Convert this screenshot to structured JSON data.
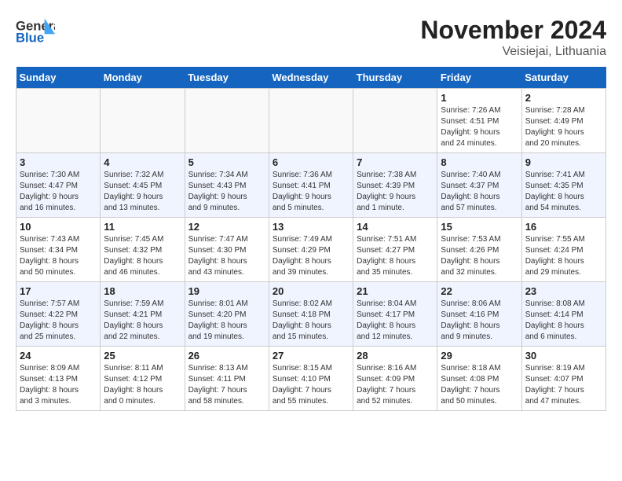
{
  "header": {
    "logo_line1": "General",
    "logo_line2": "Blue",
    "month": "November 2024",
    "location": "Veisiejai, Lithuania"
  },
  "weekdays": [
    "Sunday",
    "Monday",
    "Tuesday",
    "Wednesday",
    "Thursday",
    "Friday",
    "Saturday"
  ],
  "weeks": [
    [
      {
        "day": "",
        "info": ""
      },
      {
        "day": "",
        "info": ""
      },
      {
        "day": "",
        "info": ""
      },
      {
        "day": "",
        "info": ""
      },
      {
        "day": "",
        "info": ""
      },
      {
        "day": "1",
        "info": "Sunrise: 7:26 AM\nSunset: 4:51 PM\nDaylight: 9 hours\nand 24 minutes."
      },
      {
        "day": "2",
        "info": "Sunrise: 7:28 AM\nSunset: 4:49 PM\nDaylight: 9 hours\nand 20 minutes."
      }
    ],
    [
      {
        "day": "3",
        "info": "Sunrise: 7:30 AM\nSunset: 4:47 PM\nDaylight: 9 hours\nand 16 minutes."
      },
      {
        "day": "4",
        "info": "Sunrise: 7:32 AM\nSunset: 4:45 PM\nDaylight: 9 hours\nand 13 minutes."
      },
      {
        "day": "5",
        "info": "Sunrise: 7:34 AM\nSunset: 4:43 PM\nDaylight: 9 hours\nand 9 minutes."
      },
      {
        "day": "6",
        "info": "Sunrise: 7:36 AM\nSunset: 4:41 PM\nDaylight: 9 hours\nand 5 minutes."
      },
      {
        "day": "7",
        "info": "Sunrise: 7:38 AM\nSunset: 4:39 PM\nDaylight: 9 hours\nand 1 minute."
      },
      {
        "day": "8",
        "info": "Sunrise: 7:40 AM\nSunset: 4:37 PM\nDaylight: 8 hours\nand 57 minutes."
      },
      {
        "day": "9",
        "info": "Sunrise: 7:41 AM\nSunset: 4:35 PM\nDaylight: 8 hours\nand 54 minutes."
      }
    ],
    [
      {
        "day": "10",
        "info": "Sunrise: 7:43 AM\nSunset: 4:34 PM\nDaylight: 8 hours\nand 50 minutes."
      },
      {
        "day": "11",
        "info": "Sunrise: 7:45 AM\nSunset: 4:32 PM\nDaylight: 8 hours\nand 46 minutes."
      },
      {
        "day": "12",
        "info": "Sunrise: 7:47 AM\nSunset: 4:30 PM\nDaylight: 8 hours\nand 43 minutes."
      },
      {
        "day": "13",
        "info": "Sunrise: 7:49 AM\nSunset: 4:29 PM\nDaylight: 8 hours\nand 39 minutes."
      },
      {
        "day": "14",
        "info": "Sunrise: 7:51 AM\nSunset: 4:27 PM\nDaylight: 8 hours\nand 35 minutes."
      },
      {
        "day": "15",
        "info": "Sunrise: 7:53 AM\nSunset: 4:26 PM\nDaylight: 8 hours\nand 32 minutes."
      },
      {
        "day": "16",
        "info": "Sunrise: 7:55 AM\nSunset: 4:24 PM\nDaylight: 8 hours\nand 29 minutes."
      }
    ],
    [
      {
        "day": "17",
        "info": "Sunrise: 7:57 AM\nSunset: 4:22 PM\nDaylight: 8 hours\nand 25 minutes."
      },
      {
        "day": "18",
        "info": "Sunrise: 7:59 AM\nSunset: 4:21 PM\nDaylight: 8 hours\nand 22 minutes."
      },
      {
        "day": "19",
        "info": "Sunrise: 8:01 AM\nSunset: 4:20 PM\nDaylight: 8 hours\nand 19 minutes."
      },
      {
        "day": "20",
        "info": "Sunrise: 8:02 AM\nSunset: 4:18 PM\nDaylight: 8 hours\nand 15 minutes."
      },
      {
        "day": "21",
        "info": "Sunrise: 8:04 AM\nSunset: 4:17 PM\nDaylight: 8 hours\nand 12 minutes."
      },
      {
        "day": "22",
        "info": "Sunrise: 8:06 AM\nSunset: 4:16 PM\nDaylight: 8 hours\nand 9 minutes."
      },
      {
        "day": "23",
        "info": "Sunrise: 8:08 AM\nSunset: 4:14 PM\nDaylight: 8 hours\nand 6 minutes."
      }
    ],
    [
      {
        "day": "24",
        "info": "Sunrise: 8:09 AM\nSunset: 4:13 PM\nDaylight: 8 hours\nand 3 minutes."
      },
      {
        "day": "25",
        "info": "Sunrise: 8:11 AM\nSunset: 4:12 PM\nDaylight: 8 hours\nand 0 minutes."
      },
      {
        "day": "26",
        "info": "Sunrise: 8:13 AM\nSunset: 4:11 PM\nDaylight: 7 hours\nand 58 minutes."
      },
      {
        "day": "27",
        "info": "Sunrise: 8:15 AM\nSunset: 4:10 PM\nDaylight: 7 hours\nand 55 minutes."
      },
      {
        "day": "28",
        "info": "Sunrise: 8:16 AM\nSunset: 4:09 PM\nDaylight: 7 hours\nand 52 minutes."
      },
      {
        "day": "29",
        "info": "Sunrise: 8:18 AM\nSunset: 4:08 PM\nDaylight: 7 hours\nand 50 minutes."
      },
      {
        "day": "30",
        "info": "Sunrise: 8:19 AM\nSunset: 4:07 PM\nDaylight: 7 hours\nand 47 minutes."
      }
    ]
  ]
}
